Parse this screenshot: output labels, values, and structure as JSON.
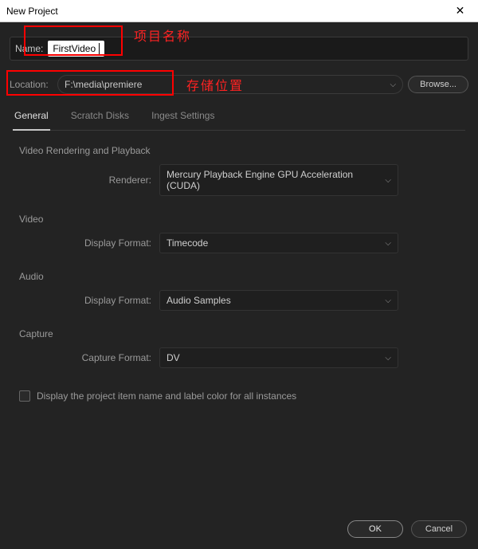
{
  "window": {
    "title": "New Project",
    "close_glyph": "✕"
  },
  "annotations": {
    "name_red": "项目名称",
    "location_red": "存储位置"
  },
  "name": {
    "label": "Name:",
    "value": "FirstVideo"
  },
  "location": {
    "label": "Location:",
    "value": "F:\\media\\premiere",
    "browse": "Browse..."
  },
  "tabs": {
    "general": "General",
    "scratch": "Scratch Disks",
    "ingest": "Ingest Settings"
  },
  "general": {
    "render_section": "Video Rendering and Playback",
    "renderer_label": "Renderer:",
    "renderer_value": "Mercury Playback Engine GPU Acceleration (CUDA)",
    "video_section": "Video",
    "video_df_label": "Display Format:",
    "video_df_value": "Timecode",
    "audio_section": "Audio",
    "audio_df_label": "Display Format:",
    "audio_df_value": "Audio Samples",
    "capture_section": "Capture",
    "capture_label": "Capture Format:",
    "capture_value": "DV"
  },
  "checkbox": {
    "label": "Display the project item name and label color for all instances"
  },
  "footer": {
    "ok": "OK",
    "cancel": "Cancel"
  }
}
